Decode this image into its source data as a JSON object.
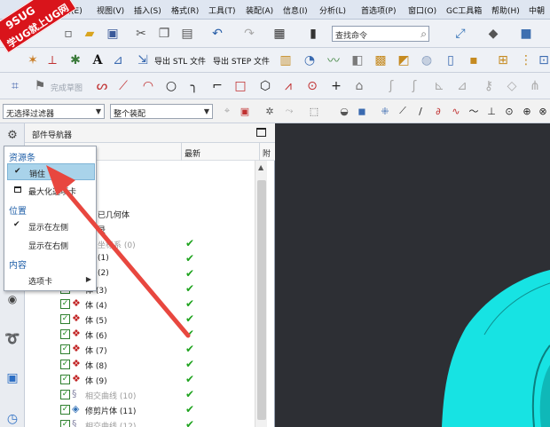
{
  "logo": {
    "line1": "9SUG",
    "line2": "学UG就上UG网"
  },
  "menu": [
    "编辑(E)",
    "视图(V)",
    "插入(S)",
    "格式(R)",
    "工具(T)",
    "装配(A)",
    "信息(I)",
    "分析(L)",
    "首选项(P)",
    "窗口(O)",
    "GC工具箱",
    "帮助(H)",
    "中朝"
  ],
  "toolbar": {
    "command_search_placeholder": "查找命令",
    "export_stl": "导出 STL 文件",
    "export_step": "导出 STEP 文件",
    "finish_sketch": "完成草图",
    "filter_select": "无选择过滤器",
    "assembly_select": "整个装配"
  },
  "navigator": {
    "title": "部件导航器",
    "col_latest": "最新",
    "col_extra": "附",
    "rows": [
      {
        "label": "",
        "gray": false,
        "tick": false,
        "check": false
      },
      {
        "label": "",
        "gray": false,
        "tick": false,
        "check": false
      },
      {
        "label": "已几何体",
        "gray": false,
        "tick": false,
        "check": false
      },
      {
        "label": "录",
        "gray": false,
        "tick": false,
        "check": false
      },
      {
        "label": "坐标系 (0)",
        "gray": true,
        "tick": true,
        "check": false
      },
      {
        "label": "(1)",
        "gray": false,
        "tick": true,
        "check": true
      },
      {
        "label": "(2)",
        "gray": false,
        "tick": true,
        "check": true
      },
      {
        "label": "体 (3)",
        "gray": false,
        "tick": true,
        "check": true
      },
      {
        "label": "体 (4)",
        "gray": false,
        "tick": true,
        "check": true
      },
      {
        "label": "体 (5)",
        "gray": false,
        "tick": true,
        "check": true
      },
      {
        "label": "体 (6)",
        "gray": false,
        "tick": true,
        "check": true
      },
      {
        "label": "体 (7)",
        "gray": false,
        "tick": true,
        "check": true
      },
      {
        "label": "体 (8)",
        "gray": false,
        "tick": true,
        "check": true
      },
      {
        "label": "体 (9)",
        "gray": false,
        "tick": true,
        "check": true
      },
      {
        "label": "相交曲线 (10)",
        "gray": true,
        "tick": true,
        "check": true
      },
      {
        "label": "修剪片体 (11)",
        "gray": false,
        "tick": true,
        "check": true
      },
      {
        "label": "相交曲线 (12)",
        "gray": true,
        "tick": true,
        "check": true
      }
    ]
  },
  "popup": {
    "section_resource": "资源条",
    "pin": "销住",
    "maximize": "最大化选项卡",
    "section_position": "位置",
    "show_left": "显示在左侧",
    "show_right": "显示在右侧",
    "section_content": "内容",
    "tabs": "选项卡"
  },
  "colors": {
    "annotation_arrow": "#e8473f",
    "model": "#17e3e3",
    "viewport_bg": "#2d2f34"
  },
  "icons": [
    "gear-icon",
    "new-file-icon",
    "open-folder-icon",
    "save-icon",
    "cut-icon",
    "copy-icon",
    "paste-icon",
    "undo-icon",
    "redo-icon",
    "search-icon",
    "fit-view-icon",
    "render-style-icon",
    "cube-view-icon",
    "text-icon",
    "sketch-icon",
    "arc-icon",
    "line-icon",
    "circle-icon",
    "rectangle-icon",
    "polygon-icon",
    "point-icon",
    "rss-icon",
    "history-icon",
    "clock-icon"
  ]
}
